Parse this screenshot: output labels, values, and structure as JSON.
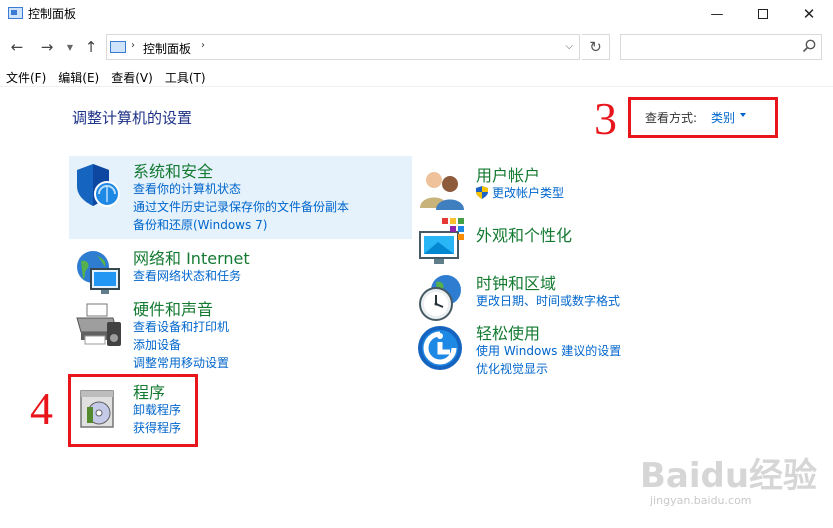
{
  "window": {
    "title": "控制面板",
    "minimize": "—",
    "close": "✕"
  },
  "nav": {
    "back": "←",
    "forward": "→",
    "dropdown": "▼",
    "up": "↑",
    "address_sep": "›",
    "address": "控制面板",
    "address_dropdown": "⌵",
    "refresh": "↻",
    "search_placeholder": ""
  },
  "menu": [
    "文件(F)",
    "编辑(E)",
    "查看(V)",
    "工具(T)"
  ],
  "main": {
    "title": "调整计算机的设置",
    "view_by_label": "查看方式:",
    "view_by_value": "类别"
  },
  "annotations": [
    "3",
    "4"
  ],
  "categories": [
    {
      "title": "系统和安全",
      "links": [
        "查看你的计算机状态",
        "通过文件历史记录保存你的文件备份副本",
        "备份和还原(Windows 7)"
      ]
    },
    {
      "title": "网络和 Internet",
      "links": [
        "查看网络状态和任务"
      ]
    },
    {
      "title": "硬件和声音",
      "links": [
        "查看设备和打印机",
        "添加设备",
        "调整常用移动设置"
      ]
    },
    {
      "title": "程序",
      "links": [
        "卸载程序",
        "获得程序"
      ]
    },
    {
      "title": "用户帐户",
      "links": [
        "更改帐户类型"
      ]
    },
    {
      "title": "外观和个性化",
      "links": []
    },
    {
      "title": "时钟和区域",
      "links": [
        "更改日期、时间或数字格式"
      ]
    },
    {
      "title": "轻松使用",
      "links": [
        "使用 Windows 建议的设置",
        "优化视觉显示"
      ]
    }
  ],
  "watermark": {
    "text": "Baidu经验",
    "url": "jingyan.baidu.com"
  },
  "colors": {
    "title_blue": "#1e3287",
    "category_green": "#147a32",
    "link_blue": "#0066cc",
    "annotation_red": "#e8161b",
    "highlight": "#e5f1fb"
  }
}
